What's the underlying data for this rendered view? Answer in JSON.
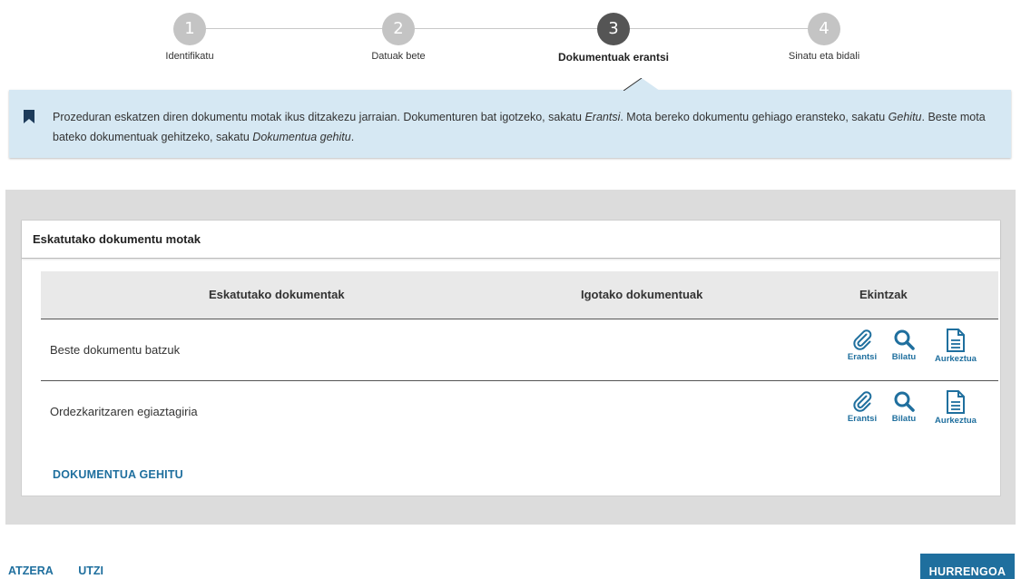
{
  "stepper": {
    "steps": [
      {
        "number": "1",
        "label": "Identifikatu"
      },
      {
        "number": "2",
        "label": "Datuak bete"
      },
      {
        "number": "3",
        "label": "Dokumentuak erantsi"
      },
      {
        "number": "4",
        "label": "Sinatu eta bidali"
      }
    ],
    "active_step": 3
  },
  "info": {
    "icon": "bookmark-icon",
    "text_part1": "Prozeduran eskatzen diren dokumentu motak ikus ditzakezu jarraian. Dokumenturen bat igotzeko, sakatu ",
    "emph1": "Erantsi",
    "text_part2": ". Mota bereko dokumentu gehiago eransteko, sakatu ",
    "emph2": "Gehitu",
    "text_part3": ". Beste mota bateko dokumentuak gehitzeko, sakatu ",
    "emph3": "Dokumentua gehitu",
    "text_part4": "."
  },
  "panel": {
    "title": "Eskatutako dokumentu motak",
    "columns": {
      "requested": "Eskatutako dokumentak",
      "uploaded": "Igotako dokumentuak",
      "actions": "Ekintzak"
    },
    "rows": [
      {
        "name": "Beste dokumentu batzuk",
        "uploaded": ""
      },
      {
        "name": "Ordezkaritzaren egiaztagiria",
        "uploaded": ""
      }
    ],
    "action_labels": {
      "attach": "Erantsi",
      "search": "Bilatu",
      "preview": "Aurkeztua"
    },
    "icons": {
      "attach": "paperclip-icon",
      "search": "magnifier-icon",
      "preview": "document-icon"
    },
    "add_document": "DOKUMENTUA GEHITU"
  },
  "footer": {
    "back": "ATZERA",
    "cancel": "UTZI",
    "next": "HURRENGOA"
  },
  "colors": {
    "accent": "#1f6f9e",
    "info_bg": "#d6e8f3",
    "step_active": "#555555",
    "step_inactive": "#c4c4c4",
    "panel_bg": "#dcdcdc"
  }
}
